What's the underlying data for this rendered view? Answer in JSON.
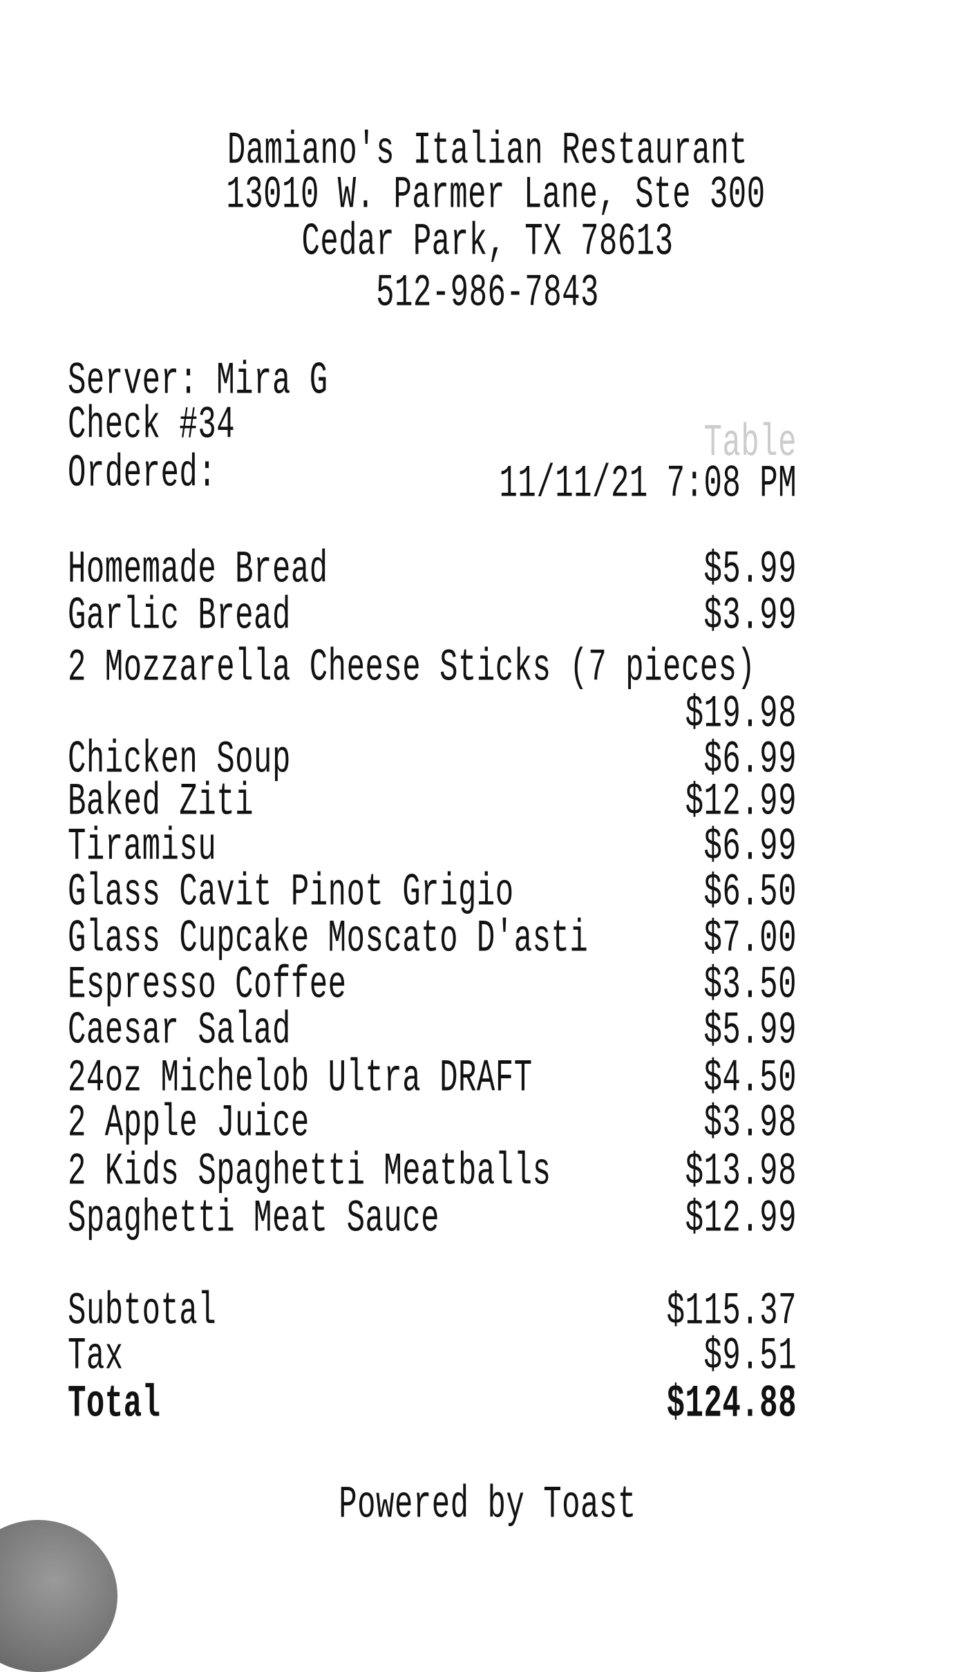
{
  "header": {
    "name": "Damiano's Italian Restaurant",
    "address": "13010 W. Parmer Lane, Ste 300",
    "city": "Cedar Park, TX 78613",
    "phone": "512-986-7843"
  },
  "meta": {
    "server": "Server: Mira G",
    "check": "Check #34",
    "table": "Table",
    "ordered_label": "Ordered:",
    "ordered_value": "11/11/21 7:08 PM"
  },
  "items": [
    {
      "name": "Homemade Bread",
      "price": "$5.99"
    },
    {
      "name": "Garlic Bread",
      "price": "$3.99"
    },
    {
      "name": "2 Mozzarella Cheese Sticks (7 pieces)",
      "price": "$19.98"
    },
    {
      "name": "Chicken Soup",
      "price": "$6.99"
    },
    {
      "name": "Baked Ziti",
      "price": "$12.99"
    },
    {
      "name": "Tiramisu",
      "price": "$6.99"
    },
    {
      "name": "Glass Cavit Pinot Grigio",
      "price": "$6.50"
    },
    {
      "name": "Glass Cupcake Moscato D'asti",
      "price": "$7.00"
    },
    {
      "name": "Espresso Coffee",
      "price": "$3.50"
    },
    {
      "name": "Caesar Salad",
      "price": "$5.99"
    },
    {
      "name": "24oz Michelob Ultra DRAFT",
      "price": "$4.50"
    },
    {
      "name": "2 Apple Juice",
      "price": "$3.98"
    },
    {
      "name": "2 Kids Spaghetti Meatballs",
      "price": "$13.98"
    },
    {
      "name": "Spaghetti Meat Sauce",
      "price": "$12.99"
    }
  ],
  "totals": {
    "subtotal_label": "Subtotal",
    "subtotal": "$115.37",
    "tax_label": "Tax",
    "tax": "$9.51",
    "total_label": "Total",
    "total": "$124.88"
  },
  "footer": "Powered by Toast"
}
